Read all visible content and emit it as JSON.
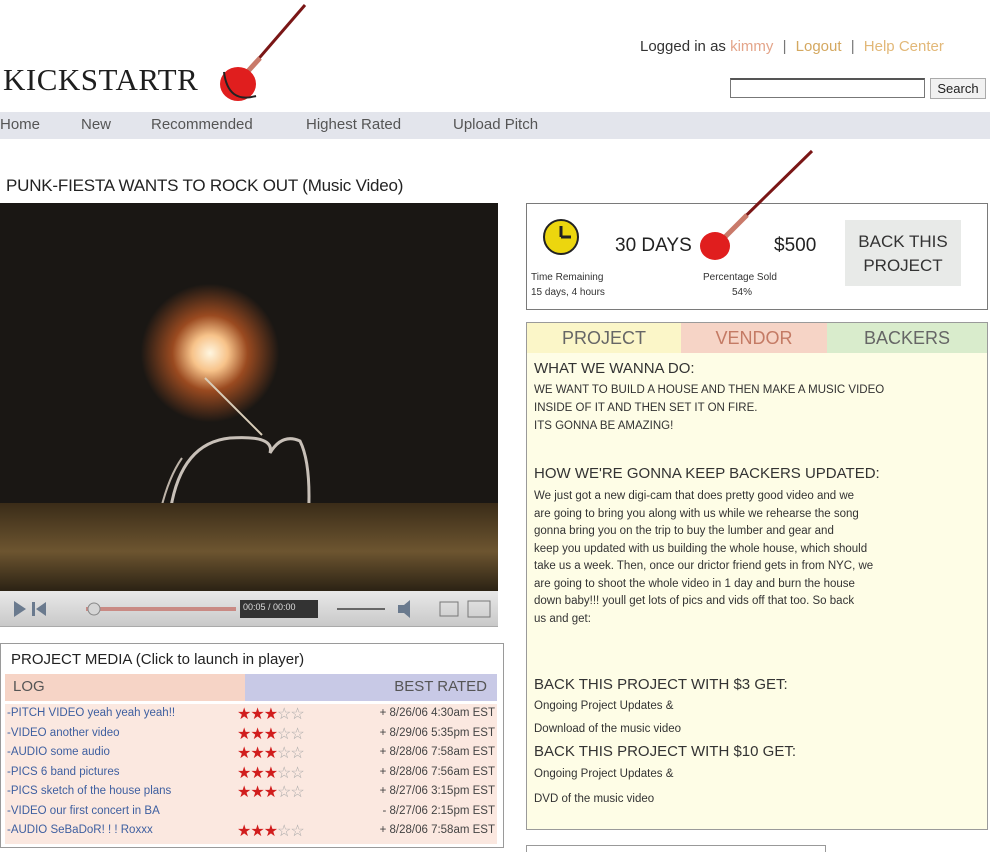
{
  "header": {
    "logo_text": "KICKSTARTR",
    "login_prefix": "Logged in as",
    "username": "kimmy",
    "logout": "Logout",
    "help": "Help Center",
    "search_label": "Search"
  },
  "nav": [
    "Home",
    "New",
    "Recommended",
    "Highest Rated",
    "Upload Pitch"
  ],
  "project": {
    "title": "PUNK-FIESTA WANTS TO ROCK OUT (Music Video)"
  },
  "stats": {
    "days": "30 DAYS",
    "amount": "$500",
    "time_label": "Time Remaining",
    "time_value": "15 days, 4 hours",
    "percent_label": "Percentage Sold",
    "percent_value": "54%",
    "back_button": "BACK THIS PROJECT"
  },
  "player": {
    "time": "00:05 / 00:00"
  },
  "media": {
    "title": "PROJECT MEDIA (Click to launch in player)",
    "col_log": "LOG",
    "col_best": "BEST RATED",
    "rows": [
      {
        "title": "-PITCH VIDEO yeah yeah yeah!!",
        "stars": 3,
        "date": "+ 8/26/06 4:30am EST"
      },
      {
        "title": "-VIDEO another video",
        "stars": 3,
        "date": "+ 8/29/06 5:35pm EST"
      },
      {
        "title": "-AUDIO some audio",
        "stars": 3,
        "date": "+ 8/28/06 7:58am EST"
      },
      {
        "title": "-PICS 6 band pictures",
        "stars": 3,
        "date": "+ 8/28/06 7:56am EST"
      },
      {
        "title": "-PICS sketch of the house plans",
        "stars": 3,
        "date": "+ 8/27/06 3:15pm EST"
      },
      {
        "title": "-VIDEO our first concert in BA",
        "stars": 0,
        "date": "- 8/27/06 2:15pm EST"
      },
      {
        "title": "-AUDIO SeBaDoR! ! ! Roxxx",
        "stars": 3,
        "date": "+ 8/28/06 7:58am EST"
      }
    ]
  },
  "tabs": [
    "PROJECT",
    "VENDOR",
    "BACKERS"
  ],
  "description": {
    "h1": "WHAT WE WANNA DO:",
    "p1a": "WE WANT TO BUILD A HOUSE AND THEN MAKE A MUSIC VIDEO",
    "p1b": "INSIDE OF IT AND THEN SET IT ON FIRE.",
    "p1c": "ITS GONNA BE AMAZING!",
    "h2": "HOW WE'RE GONNA KEEP BACKERS UPDATED:",
    "p2": [
      "We just got a new digi-cam that does pretty good video and we",
      "are going to bring you along with us while we rehearse the song",
      "gonna bring you on the trip to buy the lumber and gear and",
      "keep you updated with us building the whole house, which should",
      "take us a week.  Then, once our drictor friend gets in from NYC, we",
      "are going to shoot the whole video in 1 day and burn the house",
      "down baby!!!  youll get lots of pics and vids off that too.  So back",
      "us and get:"
    ],
    "h3": "BACK THIS PROJECT WITH $3 GET:",
    "p3a": "Ongoing Project Updates &",
    "p3b": "Download of the music video",
    "h4": "BACK THIS PROJECT WITH $10 GET:",
    "p4a": "Ongoing Project Updates &",
    "p4b": "DVD of the music video"
  },
  "colors": {
    "accent_red": "#d11d1d",
    "tab_project": "#fbf6c8",
    "tab_vendor": "#f6d4c6",
    "tab_backers": "#d9eccc"
  }
}
